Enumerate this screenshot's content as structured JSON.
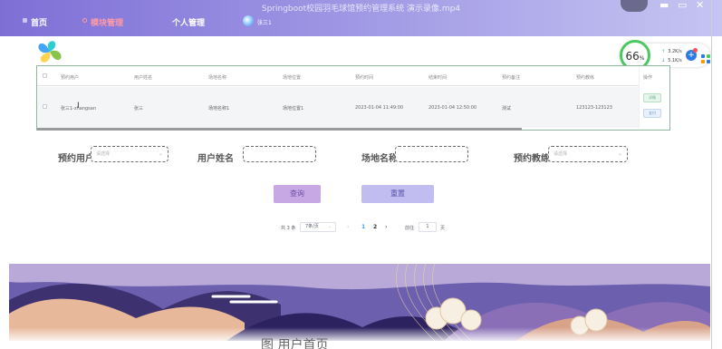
{
  "window": {
    "title": "Springboot校园羽毛球馆预约管理系统 演示录像.mp4",
    "controls": [
      "▬",
      "▭",
      "✕"
    ]
  },
  "nav": {
    "items": [
      {
        "label": "首页"
      },
      {
        "label": "模块管理"
      },
      {
        "label": "个人管理"
      }
    ],
    "active_index": 1,
    "user": "张三1"
  },
  "speed_badge": {
    "percent": "66",
    "unit": "%",
    "upload": "3.2K/s",
    "download": "5.1K/s",
    "boost_icon": "plus"
  },
  "table": {
    "columns": [
      "预约用户",
      "用户姓名",
      "场地名称",
      "场地位置",
      "预约时间",
      "结束时间",
      "预约备注",
      "预约教练",
      "操作"
    ],
    "rows": [
      {
        "cells": [
          "张三1-zhangsan",
          "张三",
          "场地名称1",
          "场地位置1",
          "2023-01-04 11:49:00",
          "2023-01-04 12:50:00",
          "测试",
          "123123-123123"
        ],
        "actions": [
          "详情",
          "支付"
        ]
      }
    ]
  },
  "search": {
    "fields": [
      {
        "label": "预约用户",
        "placeholder": "请选择",
        "type": "select"
      },
      {
        "label": "用户姓名",
        "placeholder": "",
        "type": "input"
      },
      {
        "label": "场地名称",
        "placeholder": "",
        "type": "input"
      },
      {
        "label": "预约教练",
        "placeholder": "请选择",
        "type": "select"
      }
    ],
    "search_label": "查询",
    "reset_label": "重置"
  },
  "pagination": {
    "total": "共 3 条",
    "page_size": "7条/页",
    "pages": [
      "1",
      "2"
    ],
    "current_page": "1",
    "goto_prefix": "前往",
    "goto_value": "1",
    "goto_suffix": "页"
  },
  "caption": "图 用户首页"
}
